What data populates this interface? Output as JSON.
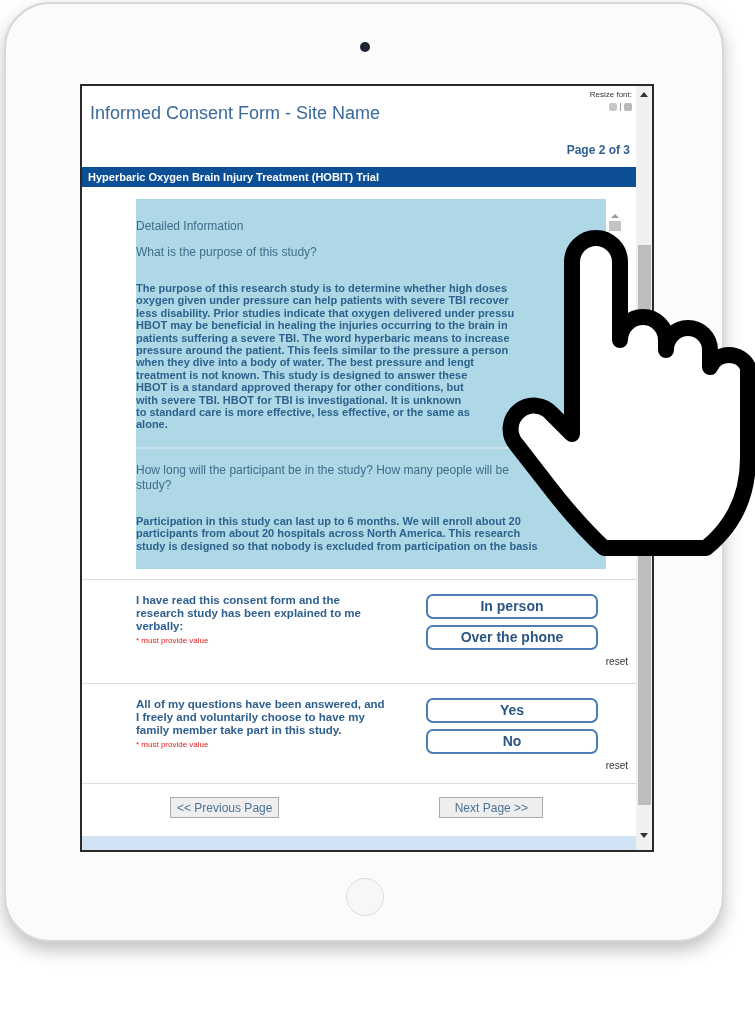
{
  "header": {
    "title": "Informed Consent Form - Site Name",
    "resize_font_label": "Resize font:",
    "page_indicator": "Page 2 of 3"
  },
  "banner": "Hyperbaric Oxygen Brain Injury Treatment (HOBIT) Trial",
  "info_panel": {
    "heading": "Detailed Information",
    "sections": [
      {
        "question": [
          "What is the purpose of this study?"
        ],
        "answer": [
          "The purpose of this research study is to determine whether high doses",
          "oxygen given under pressure can help patients with severe TBI recover",
          "less disability. Prior studies indicate that oxygen delivered under pressu",
          "HBOT may be beneficial in healing the injuries occurring to the brain in",
          "patients suffering a severe TBI. The word hyperbaric means to increase",
          "pressure around the patient. This feels similar to the pressure a person",
          "when they dive into a body of water. The best pressure and lengt",
          "treatment is not known. This study is designed to answer these",
          "HBOT is a standard approved therapy for other conditions, but",
          "with severe TBI. HBOT for TBI is investigational. It is unknown",
          "to standard care is more effective, less effective, or the same as",
          "alone."
        ]
      },
      {
        "question": [
          "How long will the participant be in the study? How many people will be",
          "study?"
        ],
        "answer": [
          "Participation in this study can last up to 6 months. We will enroll about 20",
          "participants from about 20 hospitals across North America. This research",
          "study is designed so that nobody is excluded from participation on the basis"
        ]
      }
    ]
  },
  "questions": [
    {
      "prompt": "I have read this consent form and the research study has been explained to me verbally:",
      "required_note": "* must provide value",
      "options": [
        "In person",
        "Over the phone"
      ],
      "reset": "reset"
    },
    {
      "prompt": "All of my questions have been answered, and I freely and voluntarily choose to have my family member take part in this study.",
      "required_note": "* must provide value",
      "options": [
        "Yes",
        "No"
      ],
      "reset": "reset"
    }
  ],
  "navigation": {
    "previous": "<< Previous Page",
    "next": "Next Page >>"
  }
}
